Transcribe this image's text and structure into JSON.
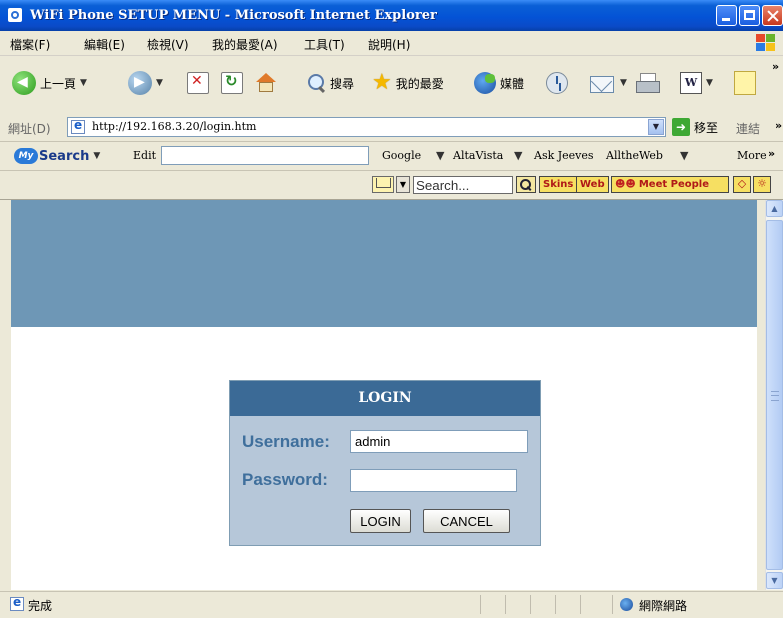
{
  "window": {
    "title": "WiFi Phone SETUP MENU - Microsoft Internet Explorer"
  },
  "menu": [
    "檔案(F)",
    "編輯(E)",
    "檢視(V)",
    "我的最愛(A)",
    "工具(T)",
    "說明(H)"
  ],
  "toolbar": {
    "back_label": "上一頁",
    "search_label": "搜尋",
    "favorites_label": "我的最愛",
    "media_label": "媒體"
  },
  "address": {
    "label": "網址(D)",
    "url": "http://192.168.3.20/login.htm",
    "go_label": "移至",
    "links_label": "連結"
  },
  "mysearch": {
    "logo": "Search",
    "edit_label": "Edit",
    "engines": [
      "Google",
      "AltaVista",
      "Ask Jeeves",
      "AlltheWeb"
    ],
    "more_label": "More"
  },
  "extbar": {
    "search_placeholder": "Search...",
    "skins_label": "Skins",
    "web_label": "Web",
    "meet_people_label": "Meet People"
  },
  "login": {
    "header": "LOGIN",
    "username_label": "Username:",
    "username_value": "admin",
    "password_label": "Password:",
    "password_value": "",
    "login_button": "LOGIN",
    "cancel_button": "CANCEL"
  },
  "status": {
    "text": "完成",
    "zone": "網際網路"
  },
  "colors": {
    "banner": "#6e97b6",
    "login_header": "#3b6a96",
    "login_body": "#b6c7d9",
    "label_text": "#3f6f9c"
  }
}
